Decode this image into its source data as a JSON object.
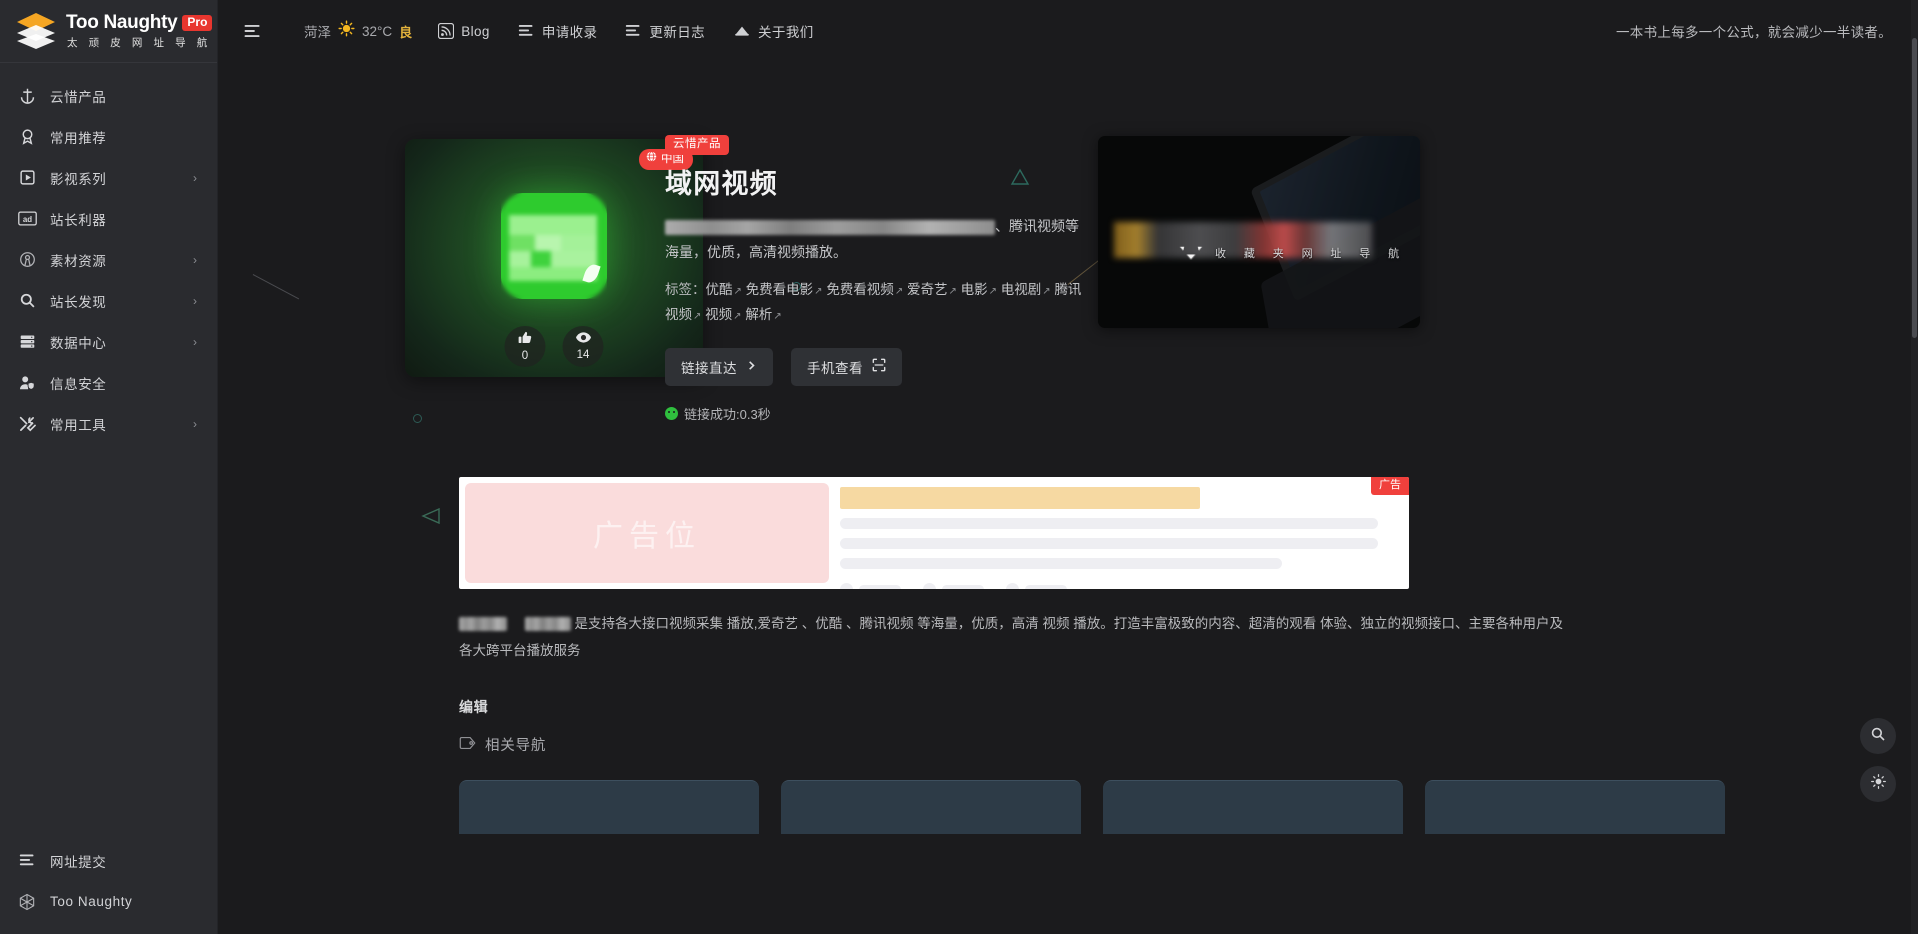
{
  "brand": {
    "name": "Too Naughty",
    "pro_badge": "Pro",
    "subtitle": "太 顽 皮 网 址 导 航",
    "logo_icon": "stacked-layers-icon",
    "accent_red": "#f0403c",
    "accent_orange": "#f5a623",
    "sidebar_bg": "#2a2b2f",
    "page_bg": "#1b1b1d"
  },
  "sidebar": {
    "items": [
      {
        "label": "云惜产品",
        "icon": "anchor-icon",
        "has_children": false
      },
      {
        "label": "常用推荐",
        "icon": "medal-icon",
        "has_children": false
      },
      {
        "label": "影视系列",
        "icon": "play-box-icon",
        "has_children": true,
        "caret": "›"
      },
      {
        "label": "站长利器",
        "icon": "ad-icon",
        "has_children": false
      },
      {
        "label": "素材资源",
        "icon": "compass-icon",
        "has_children": true,
        "caret": "›"
      },
      {
        "label": "站长发现",
        "icon": "search-icon",
        "has_children": true,
        "caret": "›"
      },
      {
        "label": "数据中心",
        "icon": "server-icon",
        "has_children": true,
        "caret": "›"
      },
      {
        "label": "信息安全",
        "icon": "user-shield-icon",
        "has_children": false
      },
      {
        "label": "常用工具",
        "icon": "tools-icon",
        "has_children": true,
        "caret": "›"
      }
    ],
    "footer_items": [
      {
        "label": "网址提交",
        "icon": "list-icon"
      },
      {
        "label": "Too Naughty",
        "icon": "hexagon-icon"
      }
    ]
  },
  "topbar": {
    "menu_toggle_icon": "hamburger-icon",
    "weather": {
      "city": "菏泽",
      "icon": "sun-icon",
      "temperature": "32°C",
      "quality": "良"
    },
    "nav": [
      {
        "label": "Blog",
        "icon": "rss-icon"
      },
      {
        "label": "申请收录",
        "icon": "list-icon"
      },
      {
        "label": "更新日志",
        "icon": "list-icon"
      },
      {
        "label": "关于我们",
        "icon": "cloud-icon"
      }
    ],
    "slogan": "一本书上每多一个公式，就会减少一半读者。"
  },
  "detail": {
    "category_badge": "云惜产品",
    "title": "域网视频",
    "country_badge": {
      "label": "中国",
      "icon": "globe-icon"
    },
    "description_prefix_redacted": true,
    "description_tail": "、腾讯视频等海量，优质，高清视频播放。",
    "tags_label": "标签：",
    "tags": [
      "优酷",
      "免费看电影",
      "免费看视频",
      "爱奇艺",
      "电影",
      "电视剧",
      "腾讯视频",
      "视频",
      "解析"
    ],
    "buttons": [
      {
        "label": "链接直达",
        "icon": "chevron-right-icon"
      },
      {
        "label": "手机查看",
        "icon": "qr-scan-icon"
      }
    ],
    "status": "链接成功:0.3秒",
    "stats": [
      {
        "name": "likes",
        "icon": "thumbs-up-icon",
        "value": "0"
      },
      {
        "name": "views",
        "icon": "eye-icon",
        "value": "14"
      }
    ],
    "app_icon": {
      "name": "app-icon",
      "color": "#2ecb2e",
      "blurred": true
    }
  },
  "promo": {
    "subtitle": "收 藏 夹 网 址 导 航",
    "logo_blurred": true,
    "image_alt": "laptop-photo"
  },
  "ad": {
    "placeholder_text": "广告位",
    "badge": "广告",
    "skeleton_lines": 3,
    "skeleton_meta_items": 3
  },
  "long_description": {
    "prefix_redacted": true,
    "text_segments": [
      {
        "type": "text",
        "value": "是支持各大接口视频采集"
      },
      {
        "type": "link",
        "value": ""
      },
      {
        "type": "text",
        "value": " 播放,爱奇艺"
      },
      {
        "type": "text",
        "value": " 、优酷"
      },
      {
        "type": "text",
        "value": " 、腾讯视频"
      },
      {
        "type": "text",
        "value": " 等海量，优质，高清"
      },
      {
        "type": "text",
        "value": " 视频"
      },
      {
        "type": "text",
        "value": " 播放。打造丰富极致的内容、超清的观看"
      },
      {
        "type": "text",
        "value": " 体验、独立的视频接口、主要各种用户及各大跨平台播放服务"
      }
    ],
    "full_text": "是支持各大接口视频采集 播放,爱奇艺 、优酷 、腾讯视频 等海量，优质，高清 视频 播放。打造丰富极致的内容、超清的观看 体验、独立的视频接口、主要各种用户及各大跨平台播放服务"
  },
  "edit_section": {
    "heading": "编辑",
    "related_label": "相关导航",
    "related_icon": "tag-icon"
  },
  "fabs": [
    {
      "name": "search-fab",
      "icon": "search-icon"
    },
    {
      "name": "theme-fab",
      "icon": "sun-icon"
    }
  ]
}
